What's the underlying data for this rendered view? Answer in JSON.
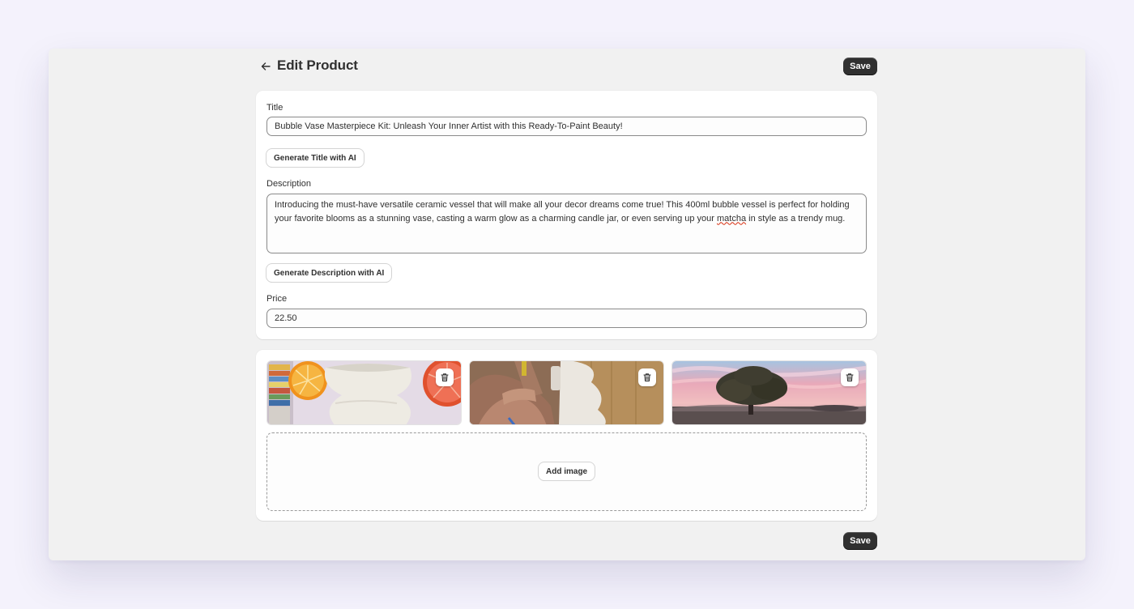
{
  "header": {
    "title": "Edit Product",
    "back_icon": "arrow-left-icon",
    "save_label": "Save"
  },
  "form": {
    "title_label": "Title",
    "title_value": "Bubble Vase Masterpiece Kit: Unleash Your Inner Artist with this Ready-To-Paint Beauty!",
    "generate_title_label": "Generate Title with AI",
    "description_label": "Description",
    "description_before": "Introducing the must-have versatile ceramic vessel that will make all your decor dreams come true! This 400ml bubble vessel is perfect for holding your favorite blooms as a stunning vase, casting a warm glow as a charming candle jar, or even serving up your ",
    "description_misspelled": "matcha",
    "description_after": " in style as a trendy mug.",
    "generate_description_label": "Generate Description with AI",
    "price_label": "Price",
    "price_value": "22.50"
  },
  "media": {
    "images": [
      {
        "subject": "white ceramic bubble vase with orange slices",
        "delete_icon": "trash-icon"
      },
      {
        "subject": "hands painting a bubble vase",
        "delete_icon": "trash-icon"
      },
      {
        "subject": "tree in field at pink sunrise",
        "delete_icon": "trash-icon"
      }
    ],
    "add_image_label": "Add image"
  },
  "footer": {
    "save_label": "Save"
  },
  "colors": {
    "page_background": "#f4f2fc",
    "window_background": "#f1f1f1",
    "card_background": "#ffffff",
    "primary_button": "#303030",
    "text": "#303030",
    "spellcheck_underline": "#d72c0d"
  }
}
